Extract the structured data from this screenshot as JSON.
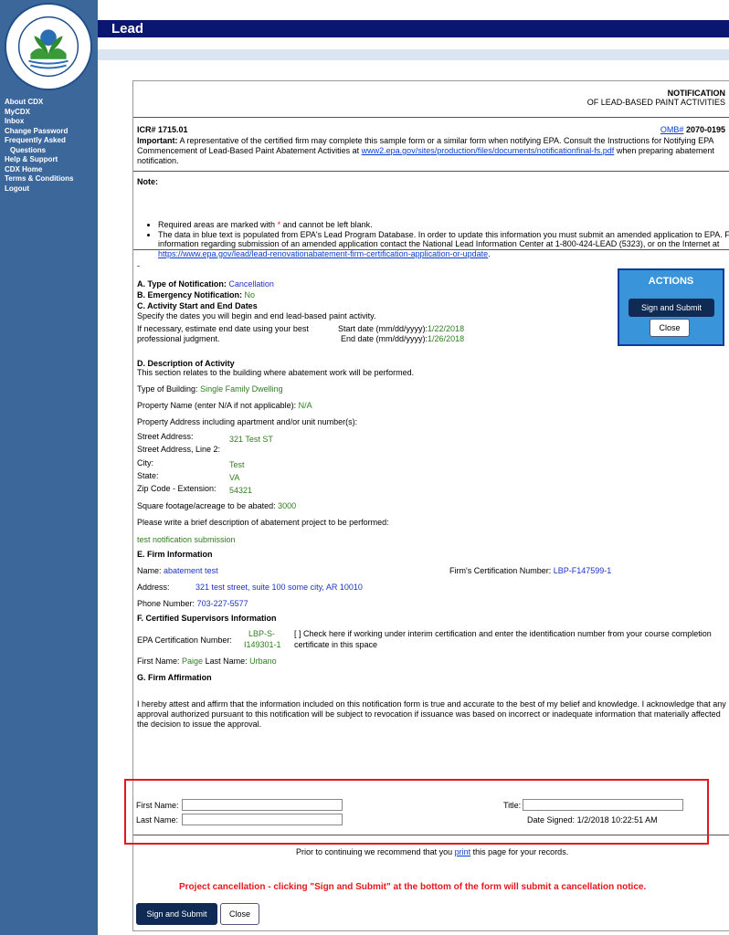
{
  "app_title": "Lead",
  "sidebar": {
    "logo_text": [
      "UNITED STATES",
      "ENVIRONMENTAL PROTECTION AGENCY"
    ],
    "items": [
      {
        "label": "About CDX"
      },
      {
        "label": "MyCDX"
      },
      {
        "label": "Inbox"
      },
      {
        "label": "Change Password"
      },
      {
        "label": "Frequently Asked"
      },
      {
        "label": "Questions"
      },
      {
        "label": "Help & Support"
      },
      {
        "label": "CDX Home"
      },
      {
        "label": "Terms & Conditions"
      },
      {
        "label": "Logout"
      }
    ]
  },
  "form": {
    "title": "NOTIFICATION",
    "subtitle": "OF LEAD-BASED PAINT ACTIVITIES",
    "icr": "ICR# 1715.01",
    "omb_link": "OMB#",
    "omb_number": "2070-0195",
    "important_label": "Important:",
    "important_text": "A representative of the certified firm may complete this sample form or a similar form when notifying EPA. Consult the Instructions for Notifying EPA Commencement of Lead-Based Paint Abatement Activities at",
    "important_link": "www2.epa.gov/sites/production/files/documents/notificationfinal-fs.pdf",
    "important_tail": "when preparing abatement notification.",
    "note_label": "Note:",
    "note1_a": "Required areas are marked with",
    "note1_star": "*",
    "note1_b": "and cannot be left blank.",
    "note2": "The data in blue text is populated from EPA's Lead Program Database. In order to update this information you must submit an amended application to EPA. For information regarding submission of an amended application contact the National Lead Information Center at 1-800-424-LEAD (5323), or on the Internet at",
    "note2_link": "https://www.epa.gov/lead/lead-renovationabatement-firm-certification-application-or-update",
    "note2_tail": ".",
    "dash": "-",
    "a_label": "A. Type of Notification:",
    "a_value": "Cancellation",
    "b_label": "B. Emergency Notification:",
    "b_value": "No",
    "c_label": "C. Activity Start and End Dates",
    "c_desc": "Specify the dates you will begin and end lead-based paint activity.",
    "c_hint1": "If necessary, estimate end date using your best",
    "c_hint2": "professional judgment.",
    "start_label": "Start date (mm/dd/yyyy):",
    "start_value": "1/22/2018",
    "end_label": "End date (mm/dd/yyyy):",
    "end_value": "1/26/2018",
    "d_label": "D. Description of Activity",
    "d_desc": "This section relates to the building where abatement work will be performed.",
    "building_label": "Type of Building:",
    "building_value": "Single Family Dwelling",
    "propname_label": "Property Name (enter N/A if not applicable):",
    "propname_value": "N/A",
    "propaddr_label": "Property Address including apartment and/or unit number(s):",
    "street_label": "Street Address:",
    "street_value": "321 Test ST",
    "street2_label": "Street Address, Line 2:",
    "city_label": "City:",
    "city_value": "Test",
    "state_label": "State:",
    "state_value": "VA",
    "zip_label": "Zip Code - Extension:",
    "zip_value": "54321",
    "sqft_label": "Square footage/acreage to be abated:",
    "sqft_value": "3000",
    "brief_label": "Please write a brief description of abatement project to be performed:",
    "brief_value": "test notification submission",
    "e_label": "E. Firm Information",
    "name_label": "Name:",
    "name_value": "abatement test",
    "cert_label": "Firm's Certification Number:",
    "cert_value": "LBP-F147599-1",
    "address_label": "Address:",
    "address_value": "321 test street, suite 100  some city, AR 10010",
    "phone_label": "Phone Number:",
    "phone_value": "703-227-5577",
    "f_label": "F. Certified Supervisors Information",
    "epa_cert_label": "EPA Certification Number:",
    "epa_cert_value1": "LBP-S-",
    "epa_cert_value2": "I149301-1",
    "interim_text1": "[ ] Check here if working under interim certification and enter the identification number from your course completion",
    "interim_text2": "certificate in this space",
    "first_label": "First Name:",
    "first_value": "Paige",
    "last_label": "Last Name:",
    "last_value": "Urbano",
    "g_label": "G. Firm Affirmation",
    "affirm_text": "I hereby attest and affirm that the information included on this notification form is true and accurate to the best of my belief and knowledge. I acknowledge that any approval authorized pursuant to this notification will be subject to revocation if issuance was based on incorrect or inadequate information that materially affected the decision to issue the approval.",
    "sig_first_label": "First Name:",
    "sig_last_label": "Last Name:",
    "sig_title_label": "Title:",
    "date_signed_label": "Date Signed:",
    "date_signed_value": "1/2/2018 10:22:51 AM",
    "print_prefix": "Prior to continuing we recommend that you",
    "print_link": "print",
    "print_suffix": "this page for your records.",
    "cancel_notice": "Project cancellation - clicking \"Sign and Submit\" at the bottom of the form will submit a cancellation notice."
  },
  "actions": {
    "title": "ACTIONS",
    "sign_submit": "Sign and Submit",
    "close": "Close"
  },
  "bottom": {
    "sign_submit": "Sign and Submit",
    "close": "Close"
  }
}
